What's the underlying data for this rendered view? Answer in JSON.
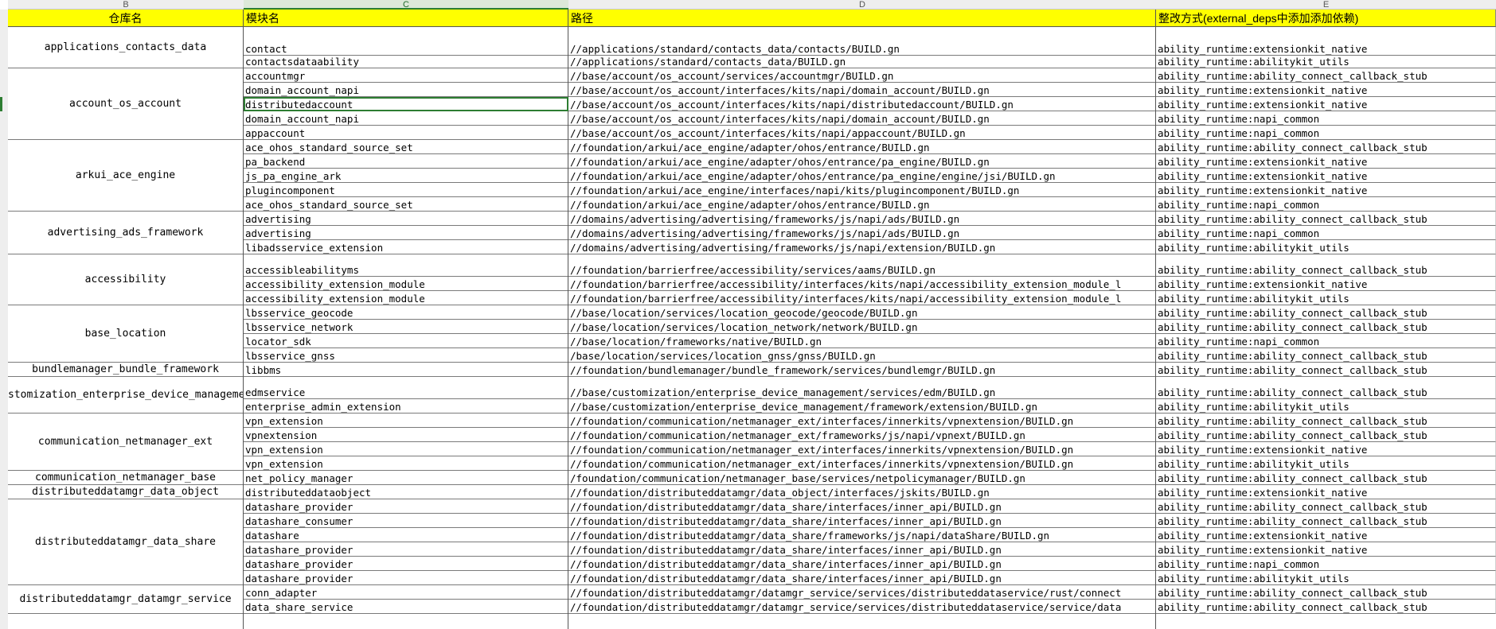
{
  "columns": [
    {
      "letter": "B"
    },
    {
      "letter": "C"
    },
    {
      "letter": "D"
    },
    {
      "letter": "E"
    }
  ],
  "headers": {
    "repo": "仓库名",
    "module": "模块名",
    "path": "路径",
    "fix": "整改方式(external_deps中添加添加依赖)"
  },
  "rows": [
    {
      "module": "contact",
      "path": "//applications/standard/contacts_data/contacts/BUILD.gn",
      "fix": "ability_runtime:extensionkit_native"
    },
    {
      "module": "contactsdataability",
      "path": "//applications/standard/contacts_data/BUILD.gn",
      "fix": "ability_runtime:abilitykit_utils"
    },
    {
      "module": "accountmgr",
      "path": "//base/account/os_account/services/accountmgr/BUILD.gn",
      "fix": "ability_runtime:ability_connect_callback_stub"
    },
    {
      "module": "domain_account_napi",
      "path": "//base/account/os_account/interfaces/kits/napi/domain_account/BUILD.gn",
      "fix": "ability_runtime:extensionkit_native"
    },
    {
      "module": "distributedaccount",
      "path": "//base/account/os_account/interfaces/kits/napi/distributedaccount/BUILD.gn",
      "fix": "ability_runtime:extensionkit_native"
    },
    {
      "module": "domain_account_napi",
      "path": "//base/account/os_account/interfaces/kits/napi/domain_account/BUILD.gn",
      "fix": "ability_runtime:napi_common"
    },
    {
      "module": "appaccount",
      "path": "//base/account/os_account/interfaces/kits/napi/appaccount/BUILD.gn",
      "fix": "ability_runtime:napi_common"
    },
    {
      "module": "ace_ohos_standard_source_set",
      "path": "//foundation/arkui/ace_engine/adapter/ohos/entrance/BUILD.gn",
      "fix": "ability_runtime:ability_connect_callback_stub"
    },
    {
      "module": "pa_backend",
      "path": "//foundation/arkui/ace_engine/adapter/ohos/entrance/pa_engine/BUILD.gn",
      "fix": "ability_runtime:extensionkit_native"
    },
    {
      "module": "js_pa_engine_ark",
      "path": "//foundation/arkui/ace_engine/adapter/ohos/entrance/pa_engine/engine/jsi/BUILD.gn",
      "fix": "ability_runtime:extensionkit_native"
    },
    {
      "module": "plugincomponent",
      "path": "//foundation/arkui/ace_engine/interfaces/napi/kits/plugincomponent/BUILD.gn",
      "fix": "ability_runtime:extensionkit_native"
    },
    {
      "module": "ace_ohos_standard_source_set",
      "path": "//foundation/arkui/ace_engine/adapter/ohos/entrance/BUILD.gn",
      "fix": "ability_runtime:napi_common"
    },
    {
      "module": "advertising",
      "path": "//domains/advertising/advertising/frameworks/js/napi/ads/BUILD.gn",
      "fix": "ability_runtime:ability_connect_callback_stub"
    },
    {
      "module": "advertising",
      "path": "//domains/advertising/advertising/frameworks/js/napi/ads/BUILD.gn",
      "fix": "ability_runtime:napi_common"
    },
    {
      "module": "libadsservice_extension",
      "path": "//domains/advertising/advertising/frameworks/js/napi/extension/BUILD.gn",
      "fix": "ability_runtime:abilitykit_utils"
    },
    {
      "module": "accessibleabilityms",
      "path": "//foundation/barrierfree/accessibility/services/aams/BUILD.gn",
      "fix": "ability_runtime:ability_connect_callback_stub"
    },
    {
      "module": "accessibility_extension_module",
      "path": "//foundation/barrierfree/accessibility/interfaces/kits/napi/accessibility_extension_module_l",
      "fix": "ability_runtime:extensionkit_native"
    },
    {
      "module": "accessibility_extension_module",
      "path": "//foundation/barrierfree/accessibility/interfaces/kits/napi/accessibility_extension_module_l",
      "fix": "ability_runtime:abilitykit_utils"
    },
    {
      "module": "lbsservice_geocode",
      "path": "//base/location/services/location_geocode/geocode/BUILD.gn",
      "fix": "ability_runtime:ability_connect_callback_stub"
    },
    {
      "module": "lbsservice_network",
      "path": "//base/location/services/location_network/network/BUILD.gn",
      "fix": "ability_runtime:ability_connect_callback_stub"
    },
    {
      "module": "locator_sdk",
      "path": "//base/location/frameworks/native/BUILD.gn",
      "fix": "ability_runtime:napi_common"
    },
    {
      "module": "lbsservice_gnss",
      "path": "/base/location/services/location_gnss/gnss/BUILD.gn",
      "fix": "ability_runtime:ability_connect_callback_stub"
    },
    {
      "module": "libbms",
      "path": "//foundation/bundlemanager/bundle_framework/services/bundlemgr/BUILD.gn",
      "fix": "ability_runtime:ability_connect_callback_stub"
    },
    {
      "module": "edmservice",
      "path": "//base/customization/enterprise_device_management/services/edm/BUILD.gn",
      "fix": "ability_runtime:ability_connect_callback_stub"
    },
    {
      "module": "enterprise_admin_extension",
      "path": "//base/customization/enterprise_device_management/framework/extension/BUILD.gn",
      "fix": "ability_runtime:abilitykit_utils"
    },
    {
      "module": "vpn_extension",
      "path": "//foundation/communication/netmanager_ext/interfaces/innerkits/vpnextension/BUILD.gn",
      "fix": "ability_runtime:ability_connect_callback_stub"
    },
    {
      "module": "vpnextension",
      "path": "//foundation/communication/netmanager_ext/frameworks/js/napi/vpnext/BUILD.gn",
      "fix": "ability_runtime:ability_connect_callback_stub"
    },
    {
      "module": "vpn_extension",
      "path": "//foundation/communication/netmanager_ext/interfaces/innerkits/vpnextension/BUILD.gn",
      "fix": "ability_runtime:extensionkit_native"
    },
    {
      "module": "vpn_extension",
      "path": "//foundation/communication/netmanager_ext/interfaces/innerkits/vpnextension/BUILD.gn",
      "fix": "ability_runtime:abilitykit_utils"
    },
    {
      "module": "net_policy_manager",
      "path": "/foundation/communication/netmanager_base/services/netpolicymanager/BUILD.gn",
      "fix": "ability_runtime:ability_connect_callback_stub"
    },
    {
      "module": "distributeddataobject",
      "path": "//foundation/distributeddatamgr/data_object/interfaces/jskits/BUILD.gn",
      "fix": "ability_runtime:extensionkit_native"
    },
    {
      "module": "datashare_provider",
      "path": "//foundation/distributeddatamgr/data_share/interfaces/inner_api/BUILD.gn",
      "fix": "ability_runtime:ability_connect_callback_stub"
    },
    {
      "module": "datashare_consumer",
      "path": "//foundation/distributeddatamgr/data_share/interfaces/inner_api/BUILD.gn",
      "fix": "ability_runtime:ability_connect_callback_stub"
    },
    {
      "module": "datashare",
      "path": "//foundation/distributeddatamgr/data_share/frameworks/js/napi/dataShare/BUILD.gn",
      "fix": "ability_runtime:extensionkit_native"
    },
    {
      "module": "datashare_provider",
      "path": "//foundation/distributeddatamgr/data_share/interfaces/inner_api/BUILD.gn",
      "fix": "ability_runtime:extensionkit_native"
    },
    {
      "module": "datashare_provider",
      "path": "//foundation/distributeddatamgr/data_share/interfaces/inner_api/BUILD.gn",
      "fix": "ability_runtime:napi_common"
    },
    {
      "module": "datashare_provider",
      "path": "//foundation/distributeddatamgr/data_share/interfaces/inner_api/BUILD.gn",
      "fix": "ability_runtime:abilitykit_utils"
    },
    {
      "module": "conn_adapter",
      "path": "//foundation/distributeddatamgr/datamgr_service/services/distributeddataservice/rust/connect",
      "fix": "ability_runtime:ability_connect_callback_stub"
    },
    {
      "module": "data_share_service",
      "path": "//foundation/distributeddatamgr/datamgr_service/services/distributeddataservice/service/data",
      "fix": "ability_runtime:ability_connect_callback_stub"
    }
  ],
  "repos": [
    {
      "name": "applications_contacts_data",
      "rows": 2
    },
    {
      "name": "account_os_account",
      "rows": 5
    },
    {
      "name": "arkui_ace_engine",
      "rows": 5
    },
    {
      "name": "advertising_ads_framework",
      "rows": 3
    },
    {
      "name": "accessibility",
      "rows": 3
    },
    {
      "name": "base_location",
      "rows": 4
    },
    {
      "name": "bundlemanager_bundle_framework",
      "rows": 1
    },
    {
      "name": "stomization_enterprise_device_manageme",
      "rows": 2
    },
    {
      "name": "communication_netmanager_ext",
      "rows": 4
    },
    {
      "name": "communication_netmanager_base",
      "rows": 1
    },
    {
      "name": "distributeddatamgr_data_object",
      "rows": 1
    },
    {
      "name": "distributeddatamgr_data_share",
      "rows": 6
    },
    {
      "name": "distributeddatamgr_datamgr_service",
      "rows": 2
    }
  ],
  "selected_row": 4,
  "colors": {
    "header_bg": "#ffff00",
    "selection": "#2d7d32"
  }
}
